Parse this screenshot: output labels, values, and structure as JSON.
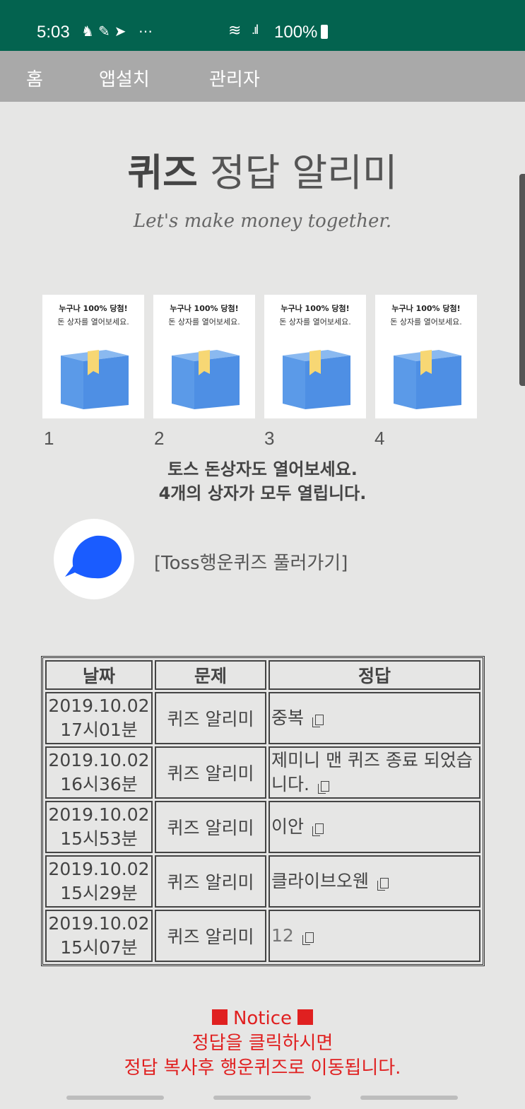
{
  "status_bar": {
    "time": "5:03",
    "icons": [
      "person-icon",
      "brush-icon",
      "send-icon",
      "more-icon"
    ],
    "signal_text": "100%"
  },
  "nav": {
    "home": "홈",
    "install": "앱설치",
    "admin": "관리자"
  },
  "title": {
    "bold": "퀴즈",
    "rest": " 정답 알리미"
  },
  "subtitle": "Let's make money together.",
  "boxes": [
    {
      "num": "1",
      "line1": "누구나 100% 당첨!",
      "line2": "돈 상자를 열어보세요."
    },
    {
      "num": "2",
      "line1": "누구나 100% 당첨!",
      "line2": "돈 상자를 열어보세요."
    },
    {
      "num": "3",
      "line1": "누구나 100% 당첨!",
      "line2": "돈 상자를 열어보세요."
    },
    {
      "num": "4",
      "line1": "누구나 100% 당첨!",
      "line2": "돈 상자를 열어보세요."
    }
  ],
  "message": {
    "line1": "토스 돈상자도 열어보세요.",
    "line2": "4개의 상자가 모두 열립니다."
  },
  "toss_link": "[Toss행운퀴즈 풀러가기]",
  "table": {
    "headers": [
      "날짜",
      "문제",
      "정답"
    ],
    "rows": [
      {
        "date1": "2019.10.02",
        "date2": "17시01분",
        "question": "퀴즈 알리미",
        "answer": "중복"
      },
      {
        "date1": "2019.10.02",
        "date2": "16시36분",
        "question": "퀴즈 알리미",
        "answer": "제미니 맨 퀴즈 종료 되었습니다."
      },
      {
        "date1": "2019.10.02",
        "date2": "15시53분",
        "question": "퀴즈 알리미",
        "answer": "이안"
      },
      {
        "date1": "2019.10.02",
        "date2": "15시29분",
        "question": "퀴즈 알리미",
        "answer": "클라이브오웬"
      },
      {
        "date1": "2019.10.02",
        "date2": "15시07분",
        "question": "퀴즈 알리미",
        "answer": "12"
      }
    ]
  },
  "notice": {
    "title": "Notice",
    "line1": "정답을 클릭하시면",
    "line2": "정답 복사후 행운퀴즈로 이동됩니다."
  },
  "colors": {
    "status_bar": "#03634f",
    "nav": "#a9a9a9",
    "notice": "#e02020",
    "box_blue": "#5b9ae8",
    "ribbon": "#f7d774",
    "toss_blue": "#1a5cff"
  }
}
